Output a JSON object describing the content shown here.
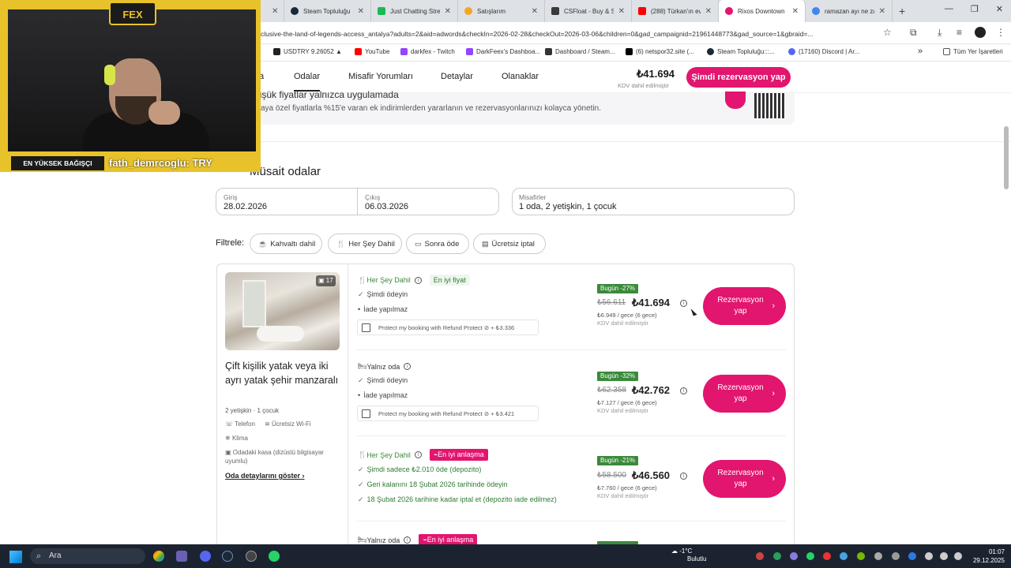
{
  "browser": {
    "tabs": [
      {
        "label": "",
        "color": "#888888",
        "active": false
      },
      {
        "label": "Steam Topluluğu",
        "color": "#1b2838",
        "active": false
      },
      {
        "label": "Just Chatting Stre",
        "color": "#1db954",
        "active": false
      },
      {
        "label": "Satışlarım",
        "color": "#f5a623",
        "active": false
      },
      {
        "label": "CSFloat - Buy & S",
        "color": "#3a3a3a",
        "active": false
      },
      {
        "label": "(288) Türkan'ın ev",
        "color": "#ff0000",
        "active": false
      },
      {
        "label": "Rixos Downtown",
        "color": "#e2156f",
        "active": true
      },
      {
        "label": "ramazan ayı ne za",
        "color": "#4285f4",
        "active": false
      }
    ],
    "url": "clusive-the-land-of-legends-access_antalya?adults=2&aid=adwords&checkIn=2026-02-28&checkOut=2026-03-06&children=0&gad_campaignid=21961448773&gad_source=1&gbraid=...",
    "bookmarks": [
      {
        "label": "USDTRY 9.26052 ▲",
        "color": "#222222"
      },
      {
        "label": "YouTube",
        "color": "#ff0000"
      },
      {
        "label": "darkfex - Twitch",
        "color": "#9146ff"
      },
      {
        "label": "DarkFeex's Dashboa...",
        "color": "#9146ff"
      },
      {
        "label": "Dashboard / Steam...",
        "color": "#333333"
      },
      {
        "label": "(6) netspor32.site (...",
        "color": "#000000"
      },
      {
        "label": "Steam Topluluğu:::...",
        "color": "#1b2838"
      },
      {
        "label": "(17160) Discord | Ar...",
        "color": "#5865f2"
      },
      {
        "label": "Tüm Yer İşaretleri",
        "color": "#555555"
      }
    ],
    "more_bookmarks": "»"
  },
  "site_nav": {
    "links": [
      "a",
      "Odalar",
      "Misafir Yorumları",
      "Detaylar",
      "Olanaklar"
    ],
    "price": "₺41.694",
    "price_note": "KDV dahil edilmiştir",
    "cta": "Şimdi rezervasyon yap"
  },
  "promo": {
    "title": "düşük fiyatlar yalnızca uygulamada",
    "subtitle": "aya özel fiyatlarla %15'e varan ek indirimlerden yararlanın ve rezervasyonlarınızı kolayca yönetin."
  },
  "availability": {
    "title": "Müsait odalar",
    "checkin_label": "Giriş",
    "checkin_value": "28.02.2026",
    "checkout_label": "Çıkış",
    "checkout_value": "06.03.2026",
    "guests_label": "Misafirler",
    "guests_value": "1 oda, 2 yetişkin, 1 çocuk",
    "filter_label": "Filtrele:",
    "filters": [
      "Kahvaltı dahil",
      "Her Şey Dahil",
      "Sonra öde",
      "Ücretsiz iptal"
    ]
  },
  "room": {
    "photo_count": "17",
    "title": "Çift kişilik yatak veya iki ayrı yatak şehir manzaralı",
    "occupancy": "2 yetişkin · 1 çocuk",
    "amenities": [
      "Telefon",
      "Ücretsiz Wi-Fi",
      "Klima",
      "Odadaki kasa (dizüstü bilgisayar uyumlu)"
    ],
    "details_link": "Oda detaylarını göster"
  },
  "offers": [
    {
      "type": "Her Şey Dahil",
      "badge": "En iyi fiyat",
      "lines": [
        "Şimdi ödeyin",
        "İade yapılmaz"
      ],
      "protect": "Protect my booking with Refund Protect",
      "protect_price": "+ ₺3.336",
      "discount": "Bugün -27%",
      "old_price": "₺56.611",
      "new_price": "₺41.694",
      "per_night": "₺6.949 / gece (6 gece)",
      "vat": "KDV dahil edilmiştir",
      "button": "Rezervasyon yap"
    },
    {
      "type": "Yalnız oda",
      "badge": "",
      "lines": [
        "Şimdi ödeyin",
        "İade yapılmaz"
      ],
      "protect": "Protect my booking with Refund Protect",
      "protect_price": "+ ₺3.421",
      "discount": "Bugün -32%",
      "old_price": "₺62.358",
      "new_price": "₺42.762",
      "per_night": "₺7.127 / gece (6 gece)",
      "vat": "KDV dahil edilmiştir",
      "button": "Rezervasyon yap"
    },
    {
      "type": "Her Şey Dahil",
      "badge": "En iyi anlaşma",
      "lines": [
        "Şimdi sadece ₺2.010 öde (depozito)",
        "Geri kalanını 18 Şubat 2026 tarihinde ödeyin",
        "18 Şubat 2026 tarihine kadar iptal et (depozito iade edilmez)"
      ],
      "discount": "Bugün -21%",
      "old_price": "₺58.500",
      "new_price": "₺46.560",
      "per_night": "₺7.760 / gece (6 gece)",
      "vat": "KDV dahil edilmiştir",
      "button": "Rezervasyon yap"
    },
    {
      "type": "Yalnız oda",
      "badge": "En iyi anlaşma"
    }
  ],
  "overlay": {
    "logo": "FEX",
    "donation_label": "EN YÜKSEK BAĞIŞÇI",
    "donation_value": "fath_demrcoglu: TRY"
  },
  "taskbar": {
    "search_placeholder": "Ara",
    "weather_temp": "-1°C",
    "weather_desc": "Bulutlu",
    "time": "01:07",
    "date": "29.12.2025"
  }
}
